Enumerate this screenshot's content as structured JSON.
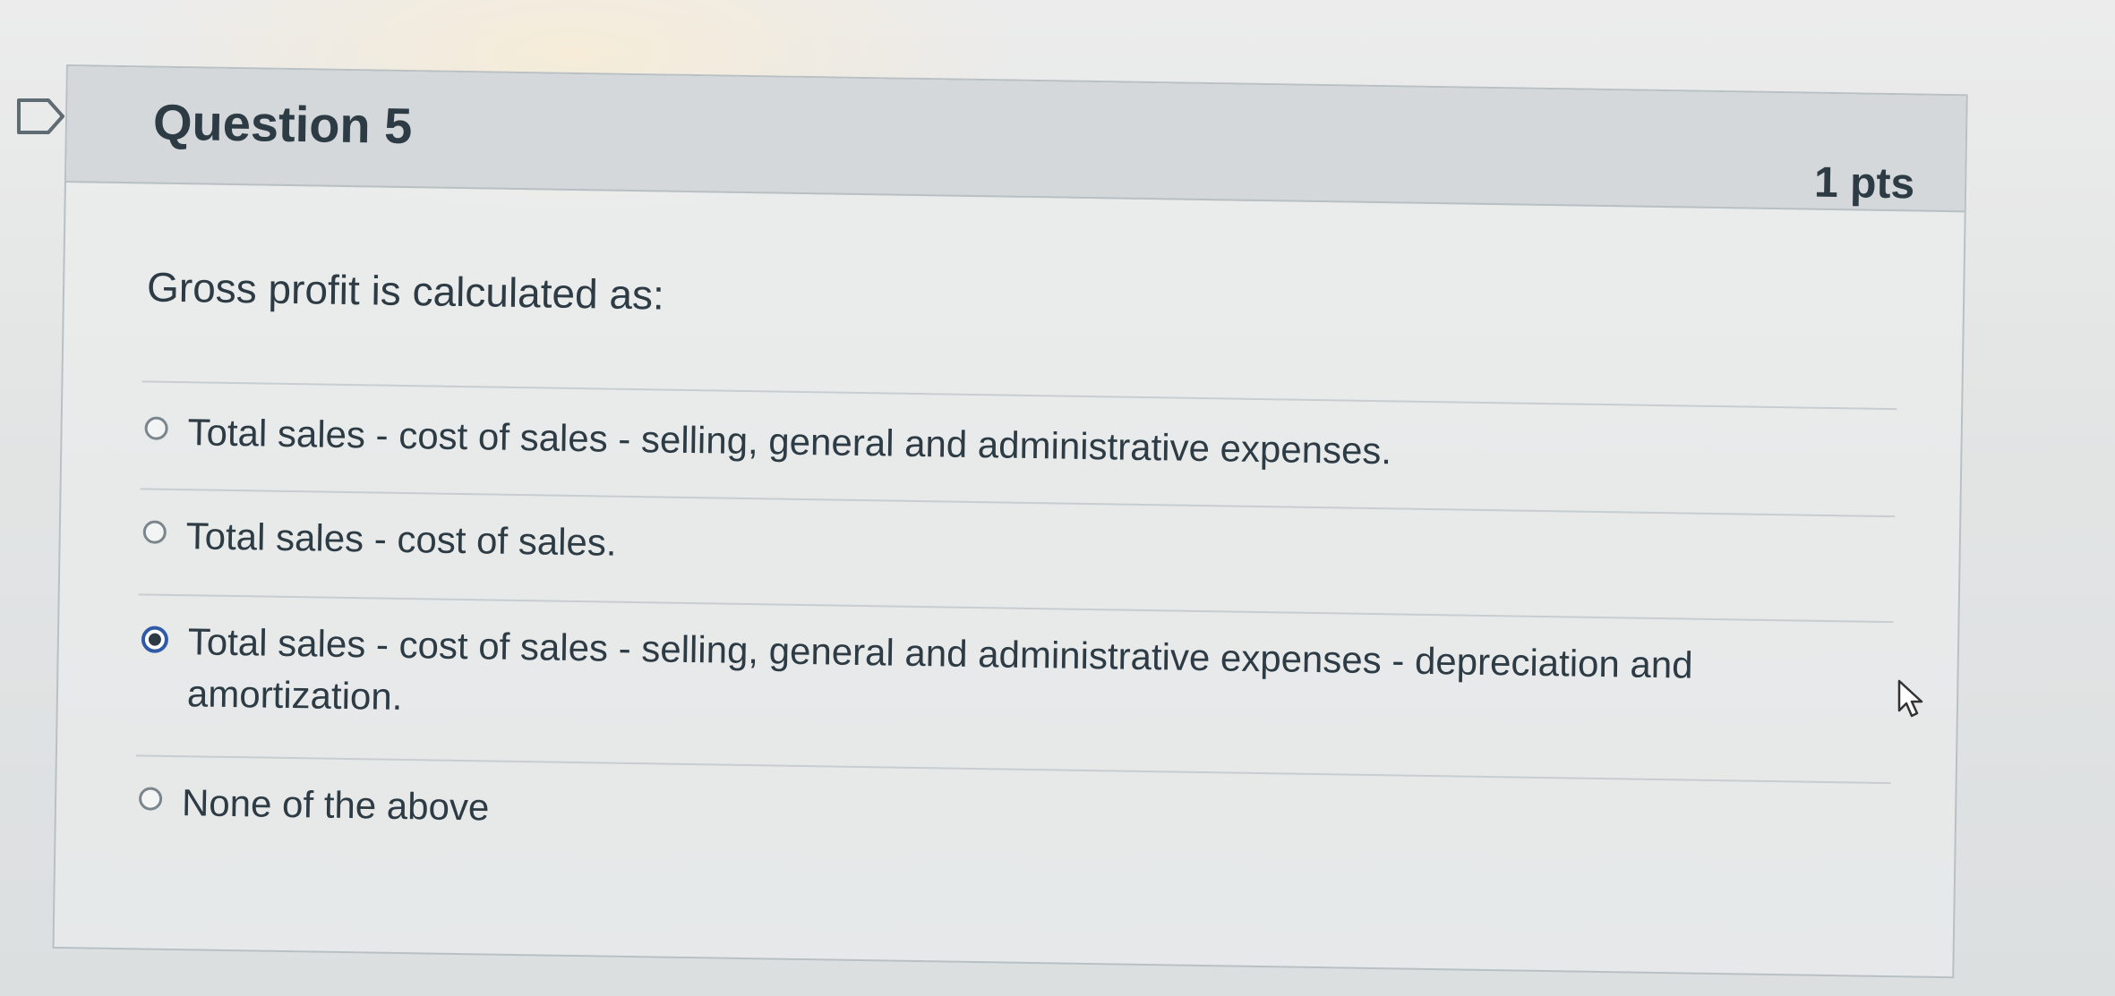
{
  "question": {
    "title": "Question 5",
    "points": "1 pts",
    "prompt": "Gross profit is calculated as:"
  },
  "answers": [
    {
      "label": "Total sales - cost of sales - selling, general and administrative expenses.",
      "selected": false
    },
    {
      "label": "Total sales - cost of sales.",
      "selected": false
    },
    {
      "label": "Total sales - cost of sales - selling, general and administrative expenses - depreciation and amortization.",
      "selected": true
    },
    {
      "label": "None of the above",
      "selected": false
    }
  ],
  "icons": {
    "flag": "flag-icon",
    "cursor": "mouse-pointer-icon",
    "radio": "radio-icon"
  },
  "colors": {
    "header_bg": "#d4d8da",
    "text": "#2d3b45",
    "selected_radio": "#2f5aa8"
  }
}
